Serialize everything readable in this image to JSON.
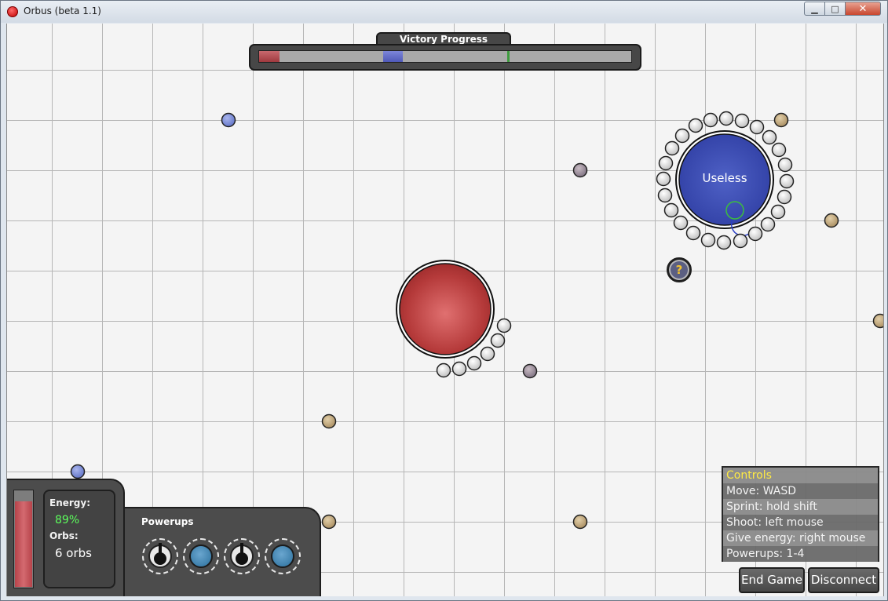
{
  "window": {
    "title": "Orbus (beta 1.1)",
    "min_glyph": "▁",
    "max_glyph": "□",
    "close_glyph": "✕"
  },
  "victory": {
    "title": "Victory Progress",
    "red_progress": 0.055,
    "blue_progress": 0.053,
    "green_progress": 0.006
  },
  "player_orb": {
    "name": "Useless",
    "color": "#3a4bb0"
  },
  "red_orb": {
    "color": "#b53a3a"
  },
  "mystery_powerup": {
    "label": "?"
  },
  "status": {
    "energy_label": "Energy:",
    "energy_value": "89%",
    "energy_fraction": 0.89,
    "orbs_label": "Orbs:",
    "orbs_value": "6 orbs"
  },
  "powerups": {
    "title": "Powerups",
    "slots": [
      {
        "icon": "bomb-icon"
      },
      {
        "icon": "orb-icon"
      },
      {
        "icon": "bomb-icon"
      },
      {
        "icon": "orb-icon"
      }
    ]
  },
  "controls": {
    "title": "Controls",
    "rows": [
      "Move: WASD",
      "Sprint: hold shift",
      "Shoot: left mouse",
      "Give energy: right mouse",
      "Powerups: 1-4"
    ]
  },
  "buttons": {
    "end_game": "End Game",
    "disconnect": "Disconnect"
  },
  "colors": {
    "accent_yellow": "#ffea3a",
    "energy_green": "#5cff5c",
    "neutral_orb_tan": "#c8ab82",
    "blue_orb": "#7e91d6",
    "purple_orb": "#9a8c9c"
  }
}
